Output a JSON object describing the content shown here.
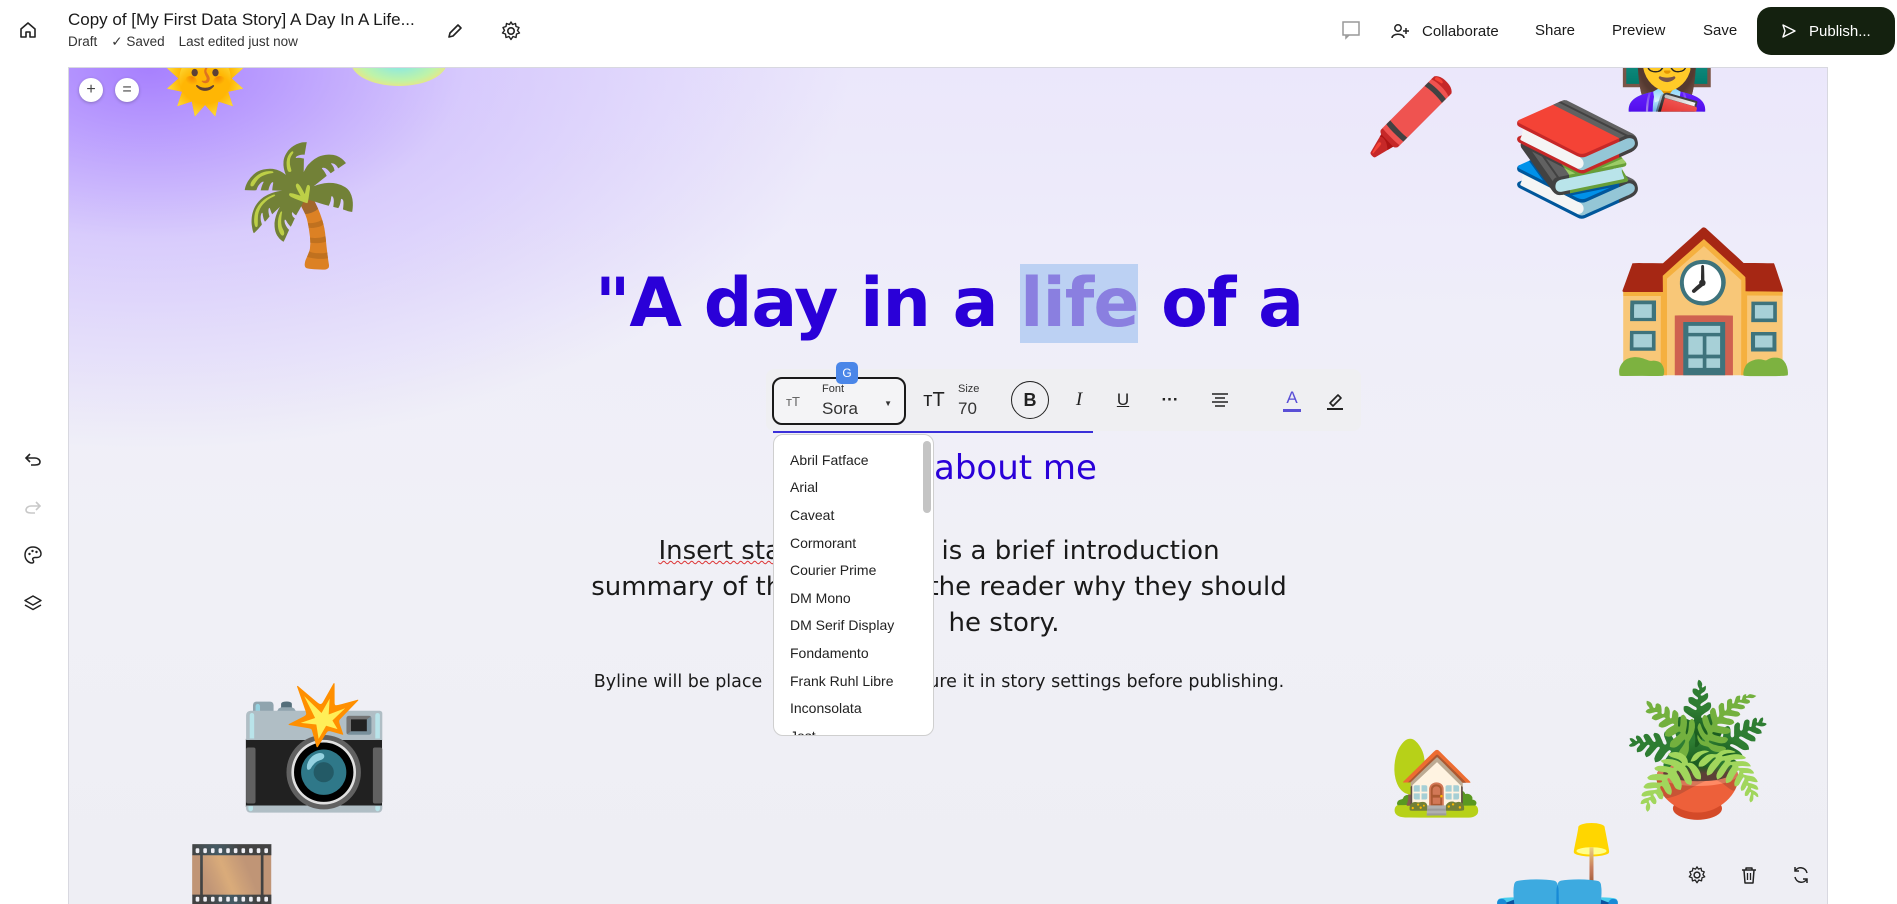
{
  "header": {
    "doc_title": "Copy of [My First Data Story] A Day In A Life...",
    "status": "Draft",
    "saved": "Saved",
    "last_edited": "Last edited just now",
    "collaborate": "Collaborate",
    "share": "Share",
    "preview": "Preview",
    "save": "Save",
    "publish": "Publish..."
  },
  "canvas": {
    "headline_before": "\"A day in a ",
    "headline_highlight": "life",
    "headline_after": " of a",
    "subhead": "about me",
    "intro_line1": "Insert sta",
    "intro_line1_cont": "his is a brief introduction",
    "intro_line2": "summary of th",
    "intro_line2_cont": "lls the reader why they should",
    "intro_line3": "he story.",
    "byline": "Byline will be place",
    "byline_cont": "igure it in story settings before publishing."
  },
  "toolbar": {
    "font_label": "Font",
    "font_value": "Sora",
    "size_label": "Size",
    "size_value": "70",
    "font_icon": "TT",
    "bold": "B",
    "italic": "I",
    "underline": "U",
    "more": "···",
    "text_color": "A"
  },
  "font_options": [
    "Abril Fatface",
    "Arial",
    "Caveat",
    "Cormorant",
    "Courier Prime",
    "DM Mono",
    "DM Serif Display",
    "Fondamento",
    "Frank Ruhl Libre",
    "Inconsolata",
    "Jost"
  ],
  "colors": {
    "accent": "#2a00d8",
    "publish_bg": "#14210f",
    "highlight": "#bcd1f3"
  },
  "emojis": [
    "🌞",
    "🌴",
    "🖍️",
    "📚",
    "🏫",
    "📸",
    "🏡",
    "🪴",
    "🎞️",
    "🛋️",
    "👩‍🏫"
  ]
}
